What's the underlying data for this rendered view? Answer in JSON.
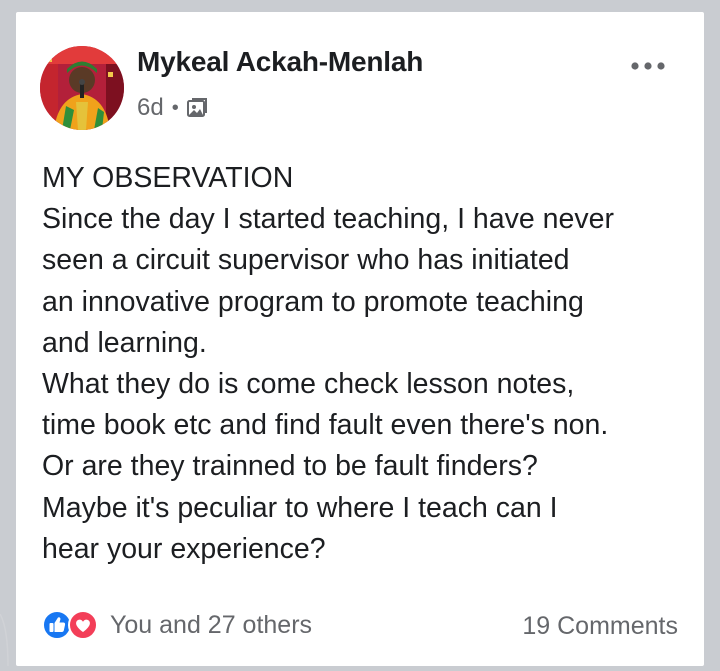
{
  "post": {
    "author": "Mykeal Ackah-Menlah",
    "timestamp": "6d",
    "separator": "•",
    "audience_icon": "photo-album-icon",
    "more_icon": "more-horizontal-icon",
    "body_lines": [
      "MY OBSERVATION",
      "Since the day I started teaching, I have never",
      "seen a circuit supervisor who has initiated",
      "an innovative program to promote teaching",
      "and learning.",
      "What they do is come check lesson notes,",
      "time book etc and find fault even there's non.",
      "Or are they trainned to be fault finders?",
      "Maybe it's peculiar to where I teach can I",
      "hear your experience?"
    ]
  },
  "footer": {
    "reaction_icons": [
      "like-icon",
      "love-icon"
    ],
    "reactions_text": "You and 27 others",
    "comments_text": "19 Comments"
  },
  "colors": {
    "background": "#c9ccd1",
    "card": "#ffffff",
    "text_primary": "#1c1e21",
    "text_secondary": "#65676b",
    "like_blue": "#1877f2",
    "love_red": "#f33e58"
  }
}
